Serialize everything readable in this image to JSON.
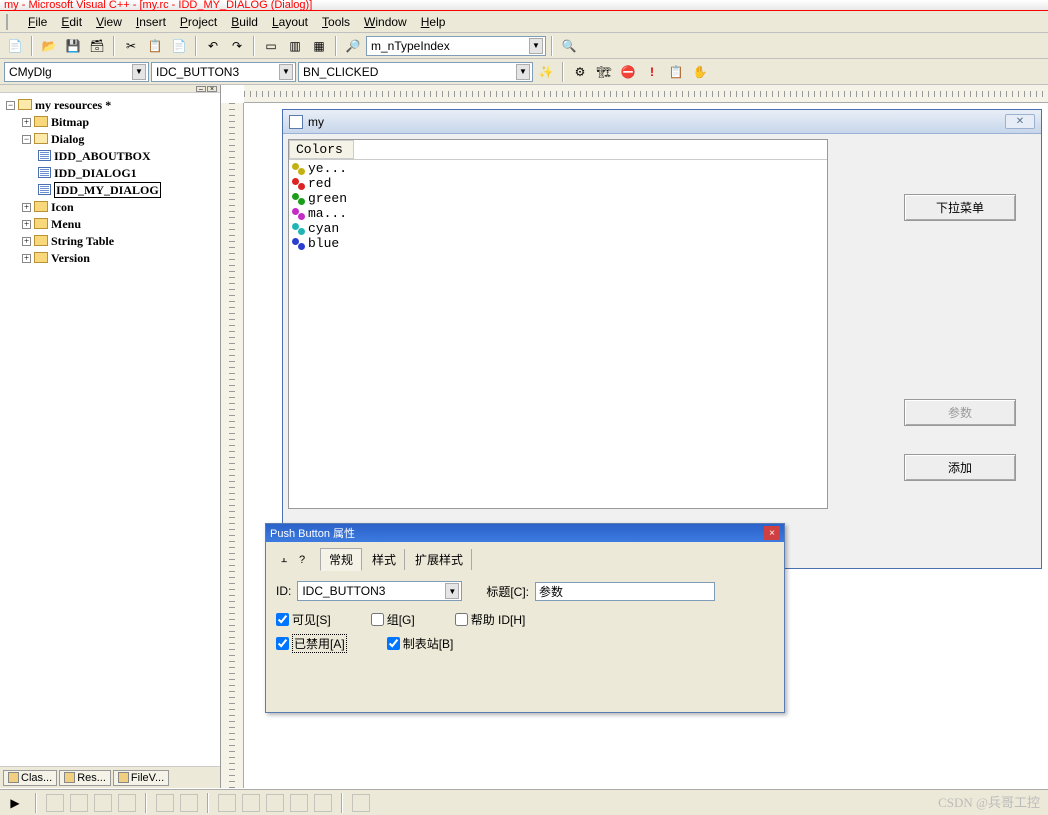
{
  "title": "my - Microsoft Visual C++ - [my.rc - IDD_MY_DIALOG (Dialog)]",
  "menu": {
    "file": "File",
    "edit": "Edit",
    "view": "View",
    "insert": "Insert",
    "project": "Project",
    "build": "Build",
    "layout": "Layout",
    "tools": "Tools",
    "window": "Window",
    "help": "Help"
  },
  "toolbar2_combo": "m_nTypeIndex",
  "combo_class": "CMyDlg",
  "combo_id": "IDC_BUTTON3",
  "combo_msg": "BN_CLICKED",
  "tree": {
    "root": "my resources *",
    "bitmap": "Bitmap",
    "dialog": "Dialog",
    "dlg_about": "IDD_ABOUTBOX",
    "dlg_1": "IDD_DIALOG1",
    "dlg_my": "IDD_MY_DIALOG",
    "icon": "Icon",
    "menu": "Menu",
    "string": "String Table",
    "version": "Version"
  },
  "tabs": {
    "class": "Clas...",
    "res": "Res...",
    "file": "FileV..."
  },
  "dialog": {
    "title": "my",
    "list_header": "Colors",
    "items": [
      {
        "sw": "ye",
        "label": "ye..."
      },
      {
        "sw": "red",
        "label": "red"
      },
      {
        "sw": "green",
        "label": "green"
      },
      {
        "sw": "ma",
        "label": "ma..."
      },
      {
        "sw": "cyan",
        "label": "cyan"
      },
      {
        "sw": "blue",
        "label": "blue"
      }
    ],
    "btn_dropdown": "下拉菜单",
    "btn_param": "参数",
    "btn_add": "添加"
  },
  "prop": {
    "title": "Push Button 属性",
    "tab_general": "常规",
    "tab_style": "样式",
    "tab_ext": "扩展样式",
    "id_label": "ID:",
    "id_value": "IDC_BUTTON3",
    "caption_label": "标题[C]:",
    "caption_value": "参数",
    "visible": "可见[S]",
    "group": "组[G]",
    "helpid": "帮助 ID[H]",
    "disabled": "已禁用[A]",
    "tabstop": "制表站[B]"
  },
  "watermark": "CSDN @兵哥工控"
}
